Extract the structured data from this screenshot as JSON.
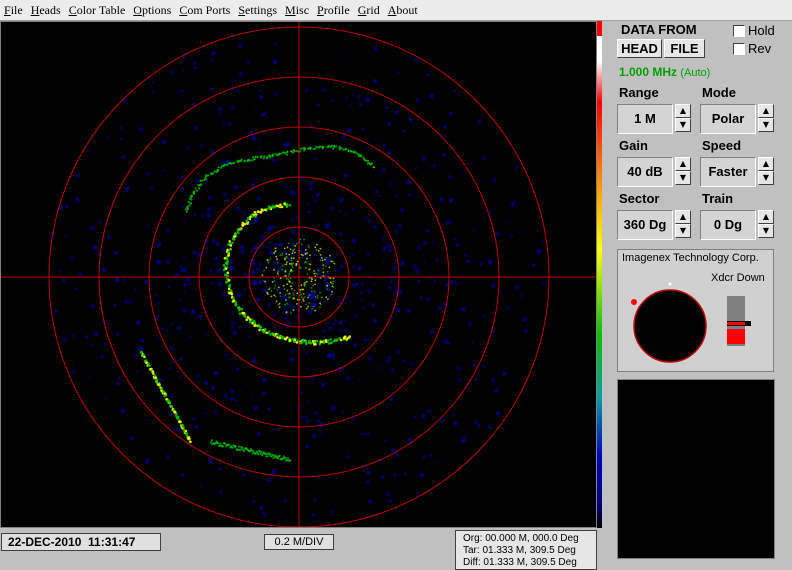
{
  "menu": [
    "File",
    "Heads",
    "Color Table",
    "Options",
    "Com Ports",
    "Settings",
    "Misc",
    "Profile",
    "Grid",
    "About"
  ],
  "panel": {
    "data_from_label": "DATA FROM",
    "head_button": "HEAD",
    "file_button": "FILE",
    "hold_label": "Hold",
    "rev_label": "Rev",
    "frequency": "1.000 MHz",
    "frequency_mode": "(Auto)",
    "range_label": "Range",
    "range_value": "1 M",
    "mode_label": "Mode",
    "mode_value": "Polar",
    "gain_label": "Gain",
    "gain_value": "40 dB",
    "speed_label": "Speed",
    "speed_value": "Faster",
    "sector_label": "Sector",
    "sector_value": "360 Dg",
    "train_label": "Train",
    "train_value": "0 Dg",
    "company": "Imagenex Technology Corp.",
    "xdcr_label": "Xdcr Down"
  },
  "status": {
    "datetime": "22-DEC-2010  11:31:47",
    "scale": "0.2 M/DIV",
    "org": "Org: 00.000 M, 000.0 Deg",
    "tar": "Tar: 01.333 M, 309.5 Deg",
    "diff": "Diff: 01.333 M, 309.5 Deg"
  },
  "colors": {
    "grid": "#c00000",
    "echo_low": "#0000a0",
    "echo_mid": "#00c000",
    "echo_high": "#ffff00",
    "background": "#000000"
  }
}
